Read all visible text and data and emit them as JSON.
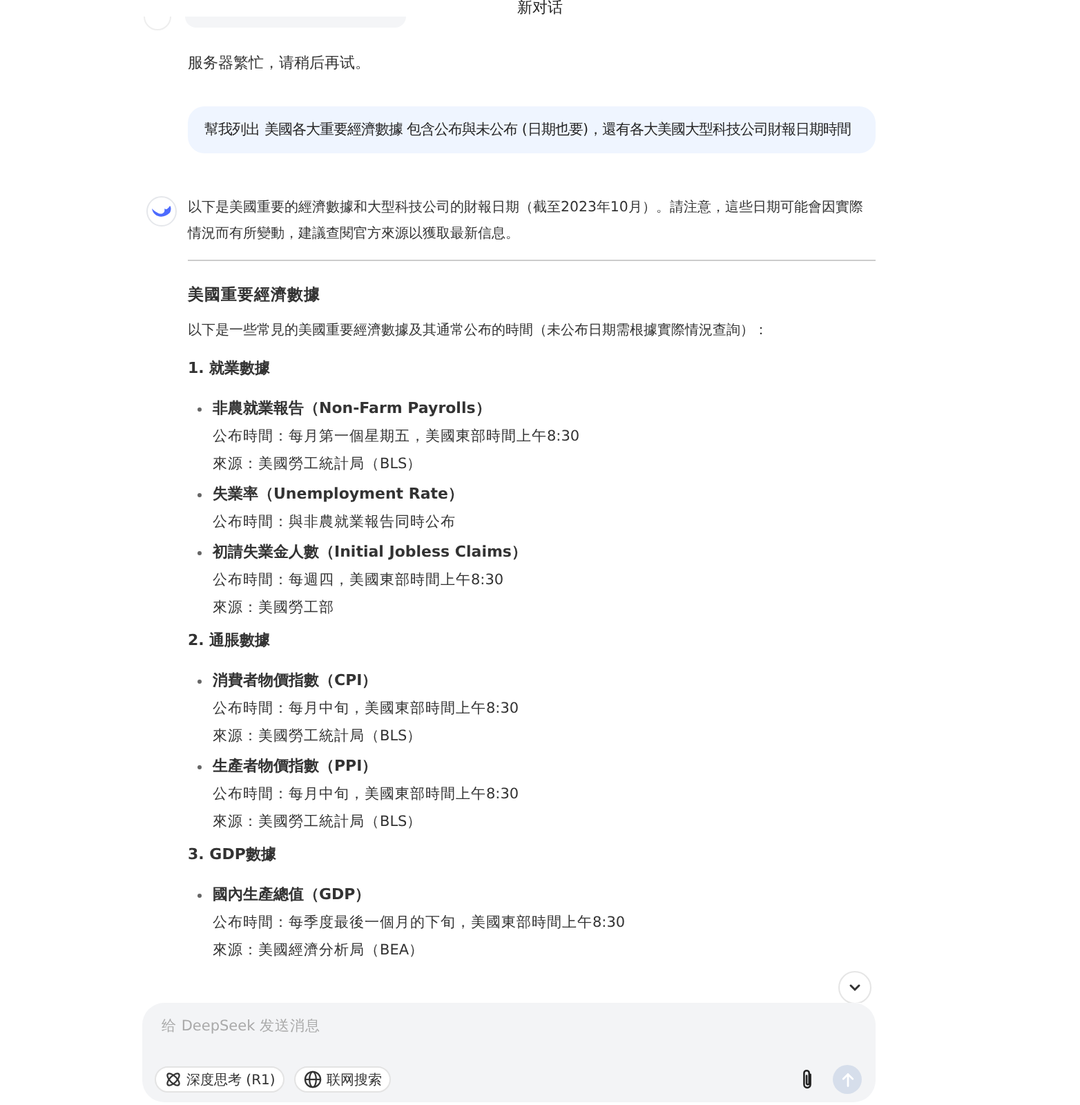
{
  "header": {
    "title": "新对话"
  },
  "messages": [
    {
      "kind": "error",
      "text": "服务器繁忙，请稍后再试。"
    },
    {
      "kind": "user",
      "text": "幫我列出  美國各大重要經濟數據 包含公布與未公布 (日期也要)，還有各大美國大型科技公司財報日期時間"
    },
    {
      "kind": "assistant",
      "blocks": [
        {
          "kind": "paragraph",
          "text": "以下是美國重要的經濟數據和大型科技公司的財報日期（截至2023年10月）。請注意，這些日期可能會因實際情況而有所變動，建議查閱官方來源以獲取最新信息。"
        },
        {
          "kind": "rule"
        },
        {
          "kind": "heading",
          "text": "美國重要經濟數據"
        },
        {
          "kind": "paragraph",
          "text": "以下是一些常見的美國重要經濟數據及其通常公布的時間（未公布日期需根據實際情況查詢）："
        },
        {
          "kind": "section",
          "text": "1. 就業數據"
        },
        {
          "kind": "bullet",
          "title": "非農就業報告（Non-Farm Payrolls）",
          "lines": [
            "公布時間：每月第一個星期五，美國東部時間上午8:30",
            "來源：美國勞工統計局（BLS）"
          ]
        },
        {
          "kind": "bullet",
          "title": "失業率（Unemployment Rate）",
          "lines": [
            "公布時間：與非農就業報告同時公布"
          ]
        },
        {
          "kind": "bullet",
          "title": "初請失業金人數（Initial Jobless Claims）",
          "lines": [
            "公布時間：每週四，美國東部時間上午8:30",
            "來源：美國勞工部"
          ]
        },
        {
          "kind": "section",
          "text": "2. 通脹數據"
        },
        {
          "kind": "bullet",
          "title": "消費者物價指數（CPI）",
          "lines": [
            "公布時間：每月中旬，美國東部時間上午8:30",
            "來源：美國勞工統計局（BLS）"
          ]
        },
        {
          "kind": "bullet",
          "title": "生產者物價指數（PPI）",
          "lines": [
            "公布時間：每月中旬，美國東部時間上午8:30",
            "來源：美國勞工統計局（BLS）"
          ]
        },
        {
          "kind": "section",
          "text": "3. GDP數據"
        },
        {
          "kind": "bullet",
          "title": "國內生產總值（GDP）",
          "lines": [
            "公布時間：每季度最後一個月的下旬，美國東部時間上午8:30",
            "來源：美國經濟分析局（BEA）"
          ]
        }
      ]
    }
  ],
  "composer": {
    "placeholder": "给 DeepSeek 发送消息",
    "toggles": [
      {
        "kind": "deep-think",
        "label": "深度思考 (R1)",
        "selected": false
      },
      {
        "kind": "web-search",
        "label": "联网搜索",
        "selected": false
      }
    ],
    "send_disabled": true
  }
}
